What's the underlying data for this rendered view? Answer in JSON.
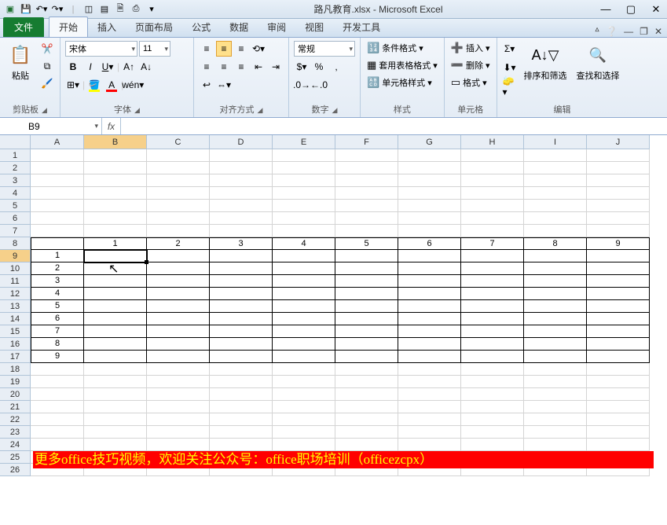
{
  "title": "路凡教育.xlsx - Microsoft Excel",
  "tabs": {
    "file": "文件",
    "home": "开始",
    "insert": "插入",
    "layout": "页面布局",
    "formula": "公式",
    "data": "数据",
    "review": "审阅",
    "view": "视图",
    "dev": "开发工具"
  },
  "groups": {
    "clipboard": {
      "label": "剪贴板",
      "paste": "粘贴"
    },
    "font": {
      "label": "字体",
      "name": "宋体",
      "size": "11"
    },
    "align": {
      "label": "对齐方式"
    },
    "number": {
      "label": "数字",
      "format": "常规"
    },
    "styles": {
      "label": "样式",
      "cond": "条件格式",
      "table": "套用表格格式",
      "cell": "单元格样式"
    },
    "cells": {
      "label": "单元格",
      "insert": "插入",
      "delete": "删除",
      "format": "格式"
    },
    "editing": {
      "label": "编辑",
      "sort": "排序和筛选",
      "find": "查找和选择"
    }
  },
  "namebox": "B9",
  "fx_label": "fx",
  "columns": [
    "A",
    "B",
    "C",
    "D",
    "E",
    "F",
    "G",
    "H",
    "I",
    "J"
  ],
  "chart_data": {
    "type": "table",
    "row8": [
      "",
      "1",
      "2",
      "3",
      "4",
      "5",
      "6",
      "7",
      "8",
      "9"
    ],
    "colA_9_17": [
      "1",
      "2",
      "3",
      "4",
      "5",
      "6",
      "7",
      "8",
      "9"
    ]
  },
  "banner": "更多office技巧视频，欢迎关注公众号：office职场培训（officezcpx）",
  "row_count": 26
}
